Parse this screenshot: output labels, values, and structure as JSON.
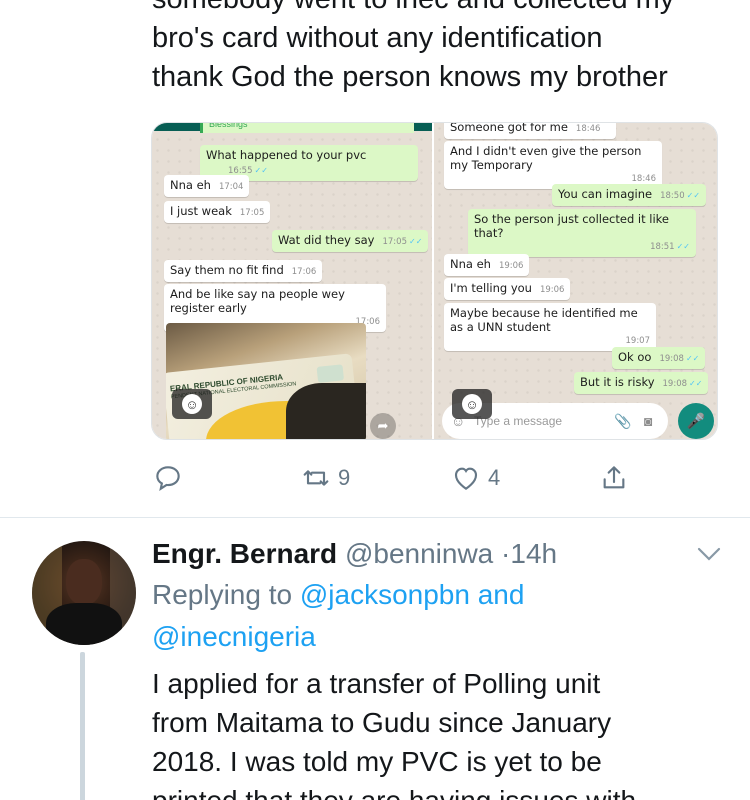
{
  "tweet": {
    "text_lines": [
      "somebody went to inec and collected my",
      "bro's card without any identification",
      "thank God the person knows my brother"
    ]
  },
  "media": {
    "left_chat": {
      "quote_header": "Blessings",
      "messages": [
        {
          "text": "What happened to your pvc",
          "time": "16:55"
        },
        {
          "text": "Nna eh",
          "time": "17:04"
        },
        {
          "text": "I just weak",
          "time": "17:05"
        },
        {
          "text": "Wat did they say",
          "time": "17:05"
        },
        {
          "text": "Say them no fit find",
          "time": "17:06"
        },
        {
          "text": "And be like say na people wey register early",
          "time": "17:06"
        }
      ],
      "card_text_1": "ERAL REPUBLIC OF NIGERIA",
      "card_text_2": "PENDENT NATIONAL ELECTORAL COMMISSION",
      "emoji_icon": "smiley-icon",
      "share_icon": "share-arrow-icon"
    },
    "right_chat": {
      "messages": [
        {
          "text": "Someone got for me",
          "time": "18:46"
        },
        {
          "text": "And I didn't even give the person my Temporary",
          "time": "18:46"
        },
        {
          "text": "You can imagine",
          "time": "18:50"
        },
        {
          "text": "So the person just collected it like that?",
          "time": "18:51"
        },
        {
          "text": "Nna eh",
          "time": "19:06"
        },
        {
          "text": "I'm telling you",
          "time": "19:06"
        },
        {
          "text": "Maybe because he identified me as a UNN student",
          "time": "19:07"
        },
        {
          "text": "Ok oo",
          "time": "19:08"
        },
        {
          "text": "But it is risky",
          "time": "19:08"
        }
      ],
      "input_placeholder": "Type a message"
    }
  },
  "actions": {
    "reply_icon": "reply-icon",
    "retweet_count": "9",
    "like_count": "4",
    "share_icon": "share-icon"
  },
  "reply_tweet": {
    "name": "Engr. Bernard",
    "handle": "@benninwa",
    "separator": "·",
    "time": "14h",
    "replying_to_label": "Replying to",
    "mention_1": "@jacksonpbn",
    "and_label": "and",
    "mention_2": "@inecnigeria",
    "body_lines": [
      "I applied for a transfer of Polling unit",
      "from Maitama to Gudu since January",
      "2018. I was told my PVC is yet to be",
      "printed that they are having issues with"
    ]
  },
  "colors": {
    "accent": "#1da1f2",
    "muted": "#657786",
    "whatsapp_out": "#dcf8c6",
    "whatsapp_green": "#128c7e"
  }
}
